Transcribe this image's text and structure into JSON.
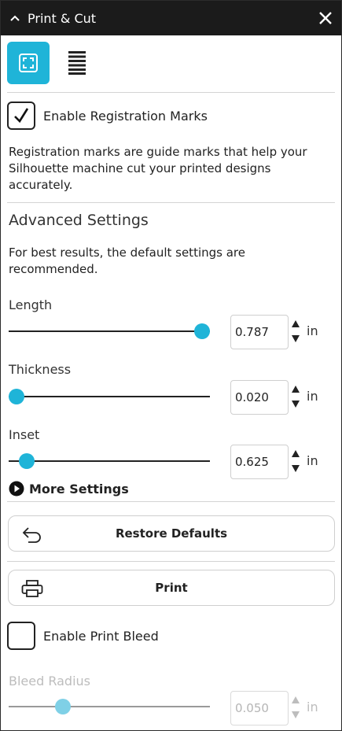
{
  "window": {
    "title": "Print & Cut"
  },
  "tabs": [
    {
      "name": "registration-tab",
      "active": true
    },
    {
      "name": "list-tab",
      "active": false
    }
  ],
  "registration": {
    "enable_label": "Enable Registration Marks",
    "enabled": true,
    "description": "Registration marks are guide marks that help your Silhouette machine cut your printed designs accurately."
  },
  "advanced": {
    "heading": "Advanced Settings",
    "note": "For best results, the default settings are recommended.",
    "sliders": {
      "length": {
        "label": "Length",
        "value": "0.787",
        "unit": "in",
        "fraction": 0.96
      },
      "thickness": {
        "label": "Thickness",
        "value": "0.020",
        "unit": "in",
        "fraction": 0.04
      },
      "inset": {
        "label": "Inset",
        "value": "0.625",
        "unit": "in",
        "fraction": 0.09
      }
    },
    "more_settings": "More Settings"
  },
  "buttons": {
    "restore_defaults": "Restore Defaults",
    "print": "Print"
  },
  "bleed": {
    "enable_label": "Enable Print Bleed",
    "enabled": false,
    "radius": {
      "label": "Bleed Radius",
      "value": "0.050",
      "unit": "in",
      "fraction": 0.27,
      "disabled": true
    }
  },
  "colors": {
    "accent": "#1fb4d8",
    "titlebar": "#1b1b1b"
  }
}
